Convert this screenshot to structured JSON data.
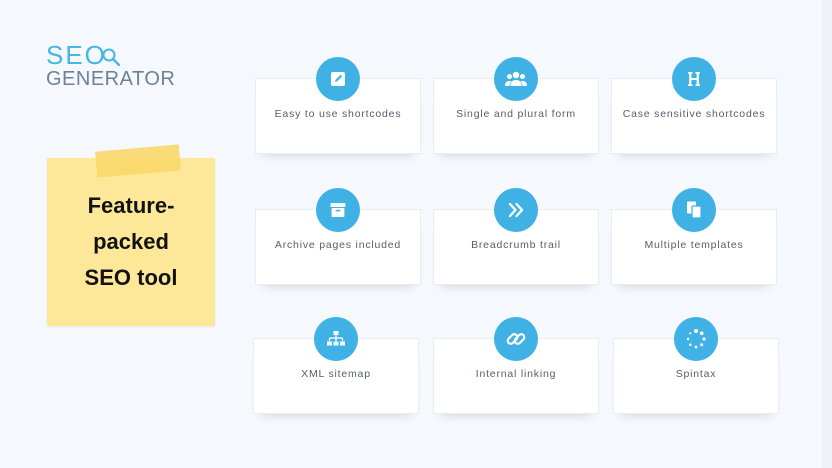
{
  "logo": {
    "line1": "SEO",
    "line2": "GENERATOR"
  },
  "note": {
    "title": "Feature-\npacked\nSEO tool"
  },
  "colors": {
    "accent": "#3fb1e4",
    "note": "#fde89a",
    "tape": "#f9d86a",
    "background": "#f5f8fc"
  },
  "features": [
    {
      "label": "Easy to use shortcodes",
      "icon": "edit-icon"
    },
    {
      "label": "Single and plural form",
      "icon": "users-icon"
    },
    {
      "label": "Case sensitive shortcodes",
      "icon": "heading-h-icon"
    },
    {
      "label": "Archive pages included",
      "icon": "archive-box-icon"
    },
    {
      "label": "Breadcrumb trail",
      "icon": "double-chevron-right-icon"
    },
    {
      "label": "Multiple templates",
      "icon": "copy-documents-icon"
    },
    {
      "label": "XML sitemap",
      "icon": "sitemap-icon"
    },
    {
      "label": "Internal linking",
      "icon": "link-icon"
    },
    {
      "label": "Spintax",
      "icon": "spinner-icon"
    }
  ]
}
